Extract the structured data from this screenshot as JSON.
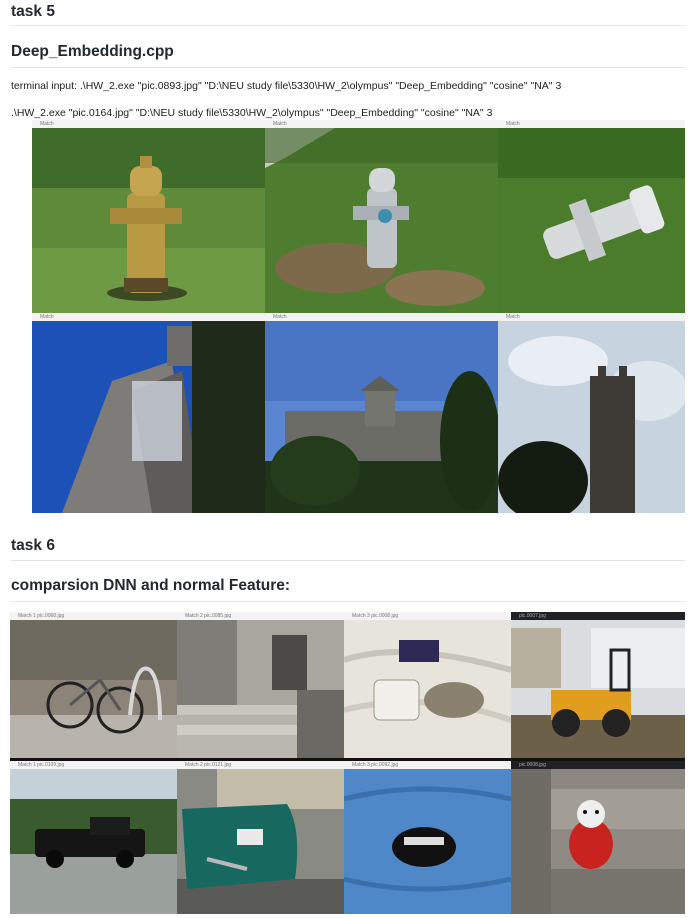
{
  "task5": {
    "heading": "task 5",
    "subheading": "Deep_Embedding.cpp",
    "command1": "terminal input: .\\HW_2.exe \"pic.0893.jpg\" \"D:\\NEU study file\\5330\\HW_2\\olympus\" \"Deep_Embedding\" \"cosine\" \"NA\" 3",
    "command2": ".\\HW_2.exe \"pic.0164.jpg\" \"D:\\NEU study file\\5330\\HW_2\\olympus\" \"Deep_Embedding\" \"cosine\" \"NA\" 3",
    "images": [
      {
        "title": "Match",
        "subject": "yellow-fire-hydrant-photo"
      },
      {
        "title": "Match",
        "subject": "silver-fire-hydrant-photo"
      },
      {
        "title": "Match",
        "subject": "fallen-fire-hydrant-photo"
      },
      {
        "title": "Match",
        "subject": "stone-building-corner-photo"
      },
      {
        "title": "Match",
        "subject": "stone-hall-with-trees-photo"
      },
      {
        "title": "Match",
        "subject": "stone-tower-photo"
      }
    ]
  },
  "task6": {
    "heading": "task 6",
    "subheading": "comparsion DNN and normal Feature:",
    "images": [
      {
        "title": "Match 1 pic.0068.jpg",
        "subject": "bicycle-at-rack-photo"
      },
      {
        "title": "Match 2 pic.0085.jpg",
        "subject": "stone-entrance-steps-photo"
      },
      {
        "title": "Match 3 pic.0008.jpg",
        "subject": "telephone-on-bed-photo"
      },
      {
        "title": "pic.0007.jpg",
        "subject": "road-roller-photo"
      },
      {
        "title": "Match 1 pic.0109.jpg",
        "subject": "black-pickup-truck-photo"
      },
      {
        "title": "Match 2 pic.0121.jpg",
        "subject": "damaged-green-car-photo"
      },
      {
        "title": "Match 3 pic.0092.jpg",
        "subject": "cap-on-blue-cushion-photo"
      },
      {
        "title": "pic.0008.jpg",
        "subject": "plush-toy-on-steps-photo"
      }
    ]
  }
}
